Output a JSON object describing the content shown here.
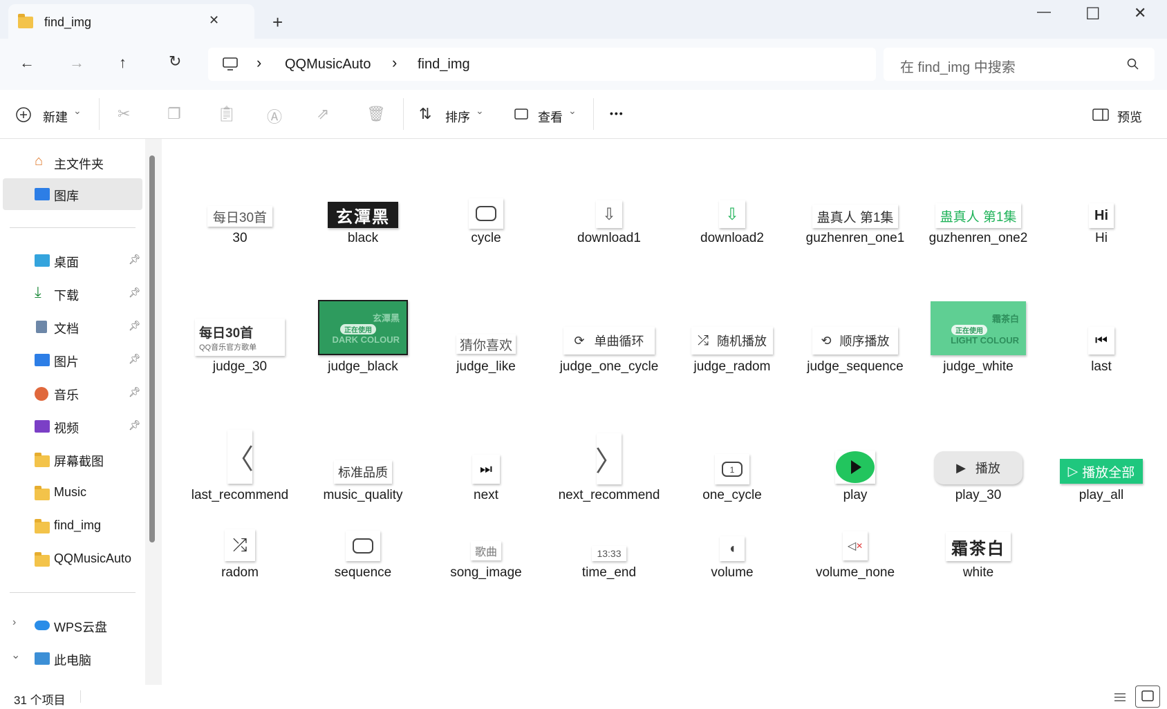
{
  "window": {
    "tab_title": "find_img",
    "tab_close": "✕",
    "new_tab": "+",
    "minimize": "—",
    "maximize": "☐",
    "close": "✕"
  },
  "nav": {
    "back": "←",
    "forward": "→",
    "up": "↑",
    "refresh": "↻"
  },
  "address": {
    "crumbs": [
      "QQMusicAuto",
      "find_img"
    ],
    "separator": "›"
  },
  "search": {
    "placeholder": "在 find_img 中搜索"
  },
  "toolbar": {
    "new_label": "新建",
    "sort_label": "排序",
    "view_label": "查看",
    "more": "•••",
    "preview_label": "预览",
    "dropdown": "⌄"
  },
  "sidebar": {
    "home": "主文件夹",
    "gallery": "图库",
    "quick": [
      {
        "label": "桌面",
        "icon": "desktop-icon",
        "pinned": true
      },
      {
        "label": "下载",
        "icon": "download-icon",
        "pinned": true
      },
      {
        "label": "文档",
        "icon": "document-icon",
        "pinned": true
      },
      {
        "label": "图片",
        "icon": "pictures-icon",
        "pinned": true
      },
      {
        "label": "音乐",
        "icon": "music-icon",
        "pinned": true
      },
      {
        "label": "视频",
        "icon": "video-icon",
        "pinned": true
      },
      {
        "label": "屏幕截图",
        "icon": "folder-icon",
        "pinned": false
      },
      {
        "label": "Music",
        "icon": "folder-icon",
        "pinned": false
      },
      {
        "label": "find_img",
        "icon": "folder-icon",
        "pinned": false
      },
      {
        "label": "QQMusicAuto",
        "icon": "folder-icon",
        "pinned": false
      }
    ],
    "wps": "WPS云盘",
    "pc": "此电脑"
  },
  "files": [
    {
      "name": "30",
      "thumb_text": "每日30首"
    },
    {
      "name": "black",
      "thumb_text": "玄潭黑"
    },
    {
      "name": "cycle",
      "thumb_text": ""
    },
    {
      "name": "download1",
      "thumb_text": ""
    },
    {
      "name": "download2",
      "thumb_text": ""
    },
    {
      "name": "guzhenren_one1",
      "thumb_text": "蛊真人 第1集"
    },
    {
      "name": "guzhenren_one2",
      "thumb_text": "蛊真人 第1集"
    },
    {
      "name": "Hi",
      "thumb_text": "Hi"
    },
    {
      "name": "judge_30",
      "thumb_text": "每日30首",
      "thumb_sub": "QQ音乐官方歌单"
    },
    {
      "name": "judge_black",
      "thumb_text": "玄潭黑",
      "thumb_sub": "正在使用",
      "thumb_sub2": "DARK COLOUR"
    },
    {
      "name": "judge_like",
      "thumb_text": "猜你喜欢"
    },
    {
      "name": "judge_one_cycle",
      "thumb_text": "单曲循环"
    },
    {
      "name": "judge_radom",
      "thumb_text": "随机播放"
    },
    {
      "name": "judge_sequence",
      "thumb_text": "顺序播放"
    },
    {
      "name": "judge_white",
      "thumb_text": "霜茶白",
      "thumb_sub": "正在使用",
      "thumb_sub2": "LIGHT COLOUR"
    },
    {
      "name": "last",
      "thumb_text": ""
    },
    {
      "name": "last_recommend",
      "thumb_text": ""
    },
    {
      "name": "music_quality",
      "thumb_text": "标准品质"
    },
    {
      "name": "next",
      "thumb_text": ""
    },
    {
      "name": "next_recommend",
      "thumb_text": ""
    },
    {
      "name": "one_cycle",
      "thumb_text": ""
    },
    {
      "name": "play",
      "thumb_text": ""
    },
    {
      "name": "play_30",
      "thumb_text": "播放"
    },
    {
      "name": "play_all",
      "thumb_text": "播放全部"
    },
    {
      "name": "radom",
      "thumb_text": ""
    },
    {
      "name": "sequence",
      "thumb_text": ""
    },
    {
      "name": "song_image",
      "thumb_text": "歌曲"
    },
    {
      "name": "time_end",
      "thumb_text": "13:33"
    },
    {
      "name": "volume",
      "thumb_text": ""
    },
    {
      "name": "volume_none",
      "thumb_text": ""
    },
    {
      "name": "white",
      "thumb_text": "霜茶白"
    }
  ],
  "status": {
    "count": "31 个项目"
  }
}
